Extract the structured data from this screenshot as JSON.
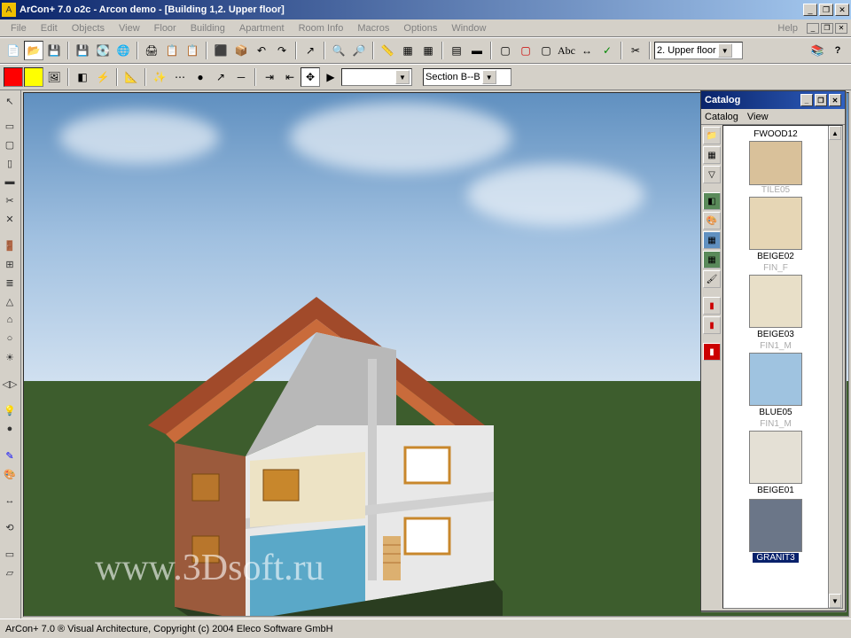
{
  "window": {
    "title": "ArCon+  7.0 o2c - Arcon demo - [Building 1,2. Upper floor]",
    "app_icon_char": "A"
  },
  "window_buttons": {
    "min": "_",
    "max": "❐",
    "close": "✕"
  },
  "menu": {
    "items": [
      "File",
      "Edit",
      "Objects",
      "View",
      "Floor",
      "Building",
      "Apartment",
      "Room Info",
      "Macros",
      "Options",
      "Window"
    ],
    "help": "Help"
  },
  "toolbar1": {
    "floor_selector": "2. Upper floor"
  },
  "toolbar2": {
    "section_selector": "Section B--B"
  },
  "catalog": {
    "title": "Catalog",
    "menu": [
      "Catalog",
      "View"
    ],
    "items": [
      {
        "label": "FWOOD12",
        "sub": "TILE05",
        "swatch": "#d9c19a"
      },
      {
        "label": "BEIGE02",
        "sub": "FIN_F",
        "swatch": "#e6d6b5"
      },
      {
        "label": "BEIGE03",
        "sub": "FIN1_M",
        "swatch": "#e8dfc8"
      },
      {
        "label": "BLUE05",
        "sub": "FIN1_M",
        "swatch": "#9fc3e0"
      },
      {
        "label": "BEIGE01",
        "sub": "",
        "swatch": "#e4e0d5"
      },
      {
        "label": "GRANIT3",
        "sub": "",
        "swatch": "#6b7688",
        "selected": true
      }
    ]
  },
  "watermark": "www.3Dsoft.ru",
  "statusbar": "ArCon+ 7.0 ® Visual Architecture, Copyright (c) 2004 Eleco Software GmbH"
}
